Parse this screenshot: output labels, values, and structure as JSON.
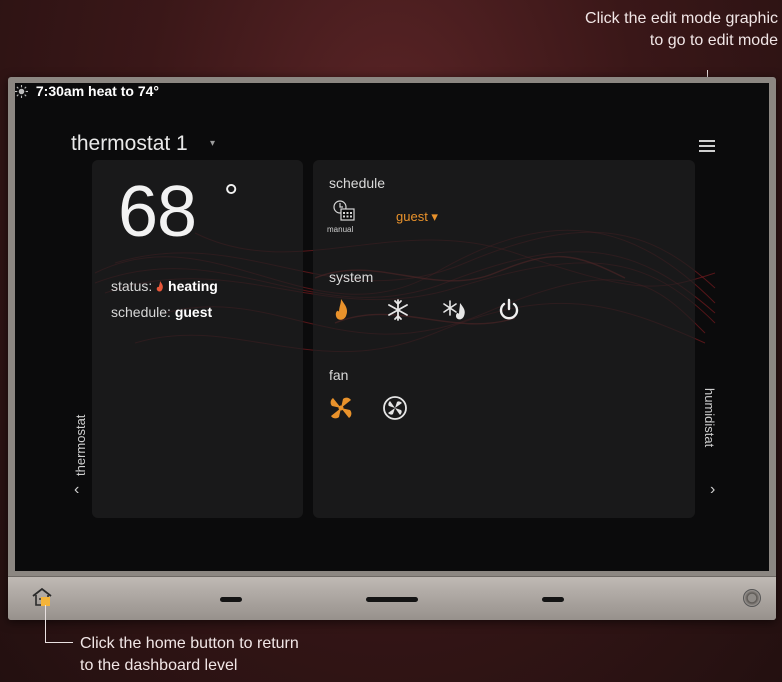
{
  "annotations": {
    "edit_line1": "Click the edit mode graphic",
    "edit_line2": "to go to edit mode",
    "home_line1": "Click the home button to return",
    "home_line2": "to the dashboard level"
  },
  "header": {
    "title": "thermostat 1",
    "title_caret": "▾"
  },
  "current": {
    "temperature": "68",
    "degree_symbol": "°",
    "status_label": "status:",
    "status_value": "heating",
    "schedule_label": "schedule:",
    "schedule_value": "guest",
    "next_event": "7:30am heat to 74°"
  },
  "schedule_section": {
    "label": "schedule",
    "mode_label": "manual",
    "selected": "guest ▾"
  },
  "system_section": {
    "label": "system",
    "icons": [
      "heat-icon",
      "cool-icon",
      "auto-icon",
      "power-off-icon"
    ]
  },
  "fan_section": {
    "label": "fan",
    "icons": [
      "fan-on-icon",
      "fan-auto-icon"
    ]
  },
  "nav": {
    "left_label": "thermostat",
    "right_label": "humidistat",
    "left_chevron": "‹",
    "right_chevron": "›"
  },
  "colors": {
    "accent": "#e9922b",
    "marker": "#f4b43a",
    "wave": "#b0232a"
  }
}
